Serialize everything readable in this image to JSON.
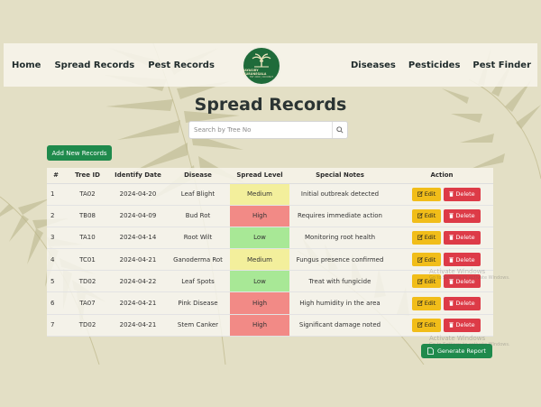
{
  "nav": {
    "left": [
      "Home",
      "Spread Records",
      "Pest Records"
    ],
    "right": [
      "Diseases",
      "Pesticides",
      "Pest Finder"
    ]
  },
  "logo": {
    "title": "JAYASIRY KURUNEGALA",
    "subtitle": "EST 2009 | COCONUT"
  },
  "page": {
    "title": "Spread Records"
  },
  "search": {
    "placeholder": "Search by Tree No"
  },
  "buttons": {
    "add": "Add New Records",
    "edit": "Edit",
    "delete": "Delete",
    "report": "Generate Report"
  },
  "table": {
    "headers": [
      "#",
      "Tree ID",
      "Identify Date",
      "Disease",
      "Spread Level",
      "Special Notes",
      "Action"
    ],
    "rows": [
      {
        "n": "1",
        "id": "TA02",
        "date": "2024-04-20",
        "disease": "Leaf Blight",
        "level": "Medium",
        "notes": "Initial outbreak detected"
      },
      {
        "n": "2",
        "id": "TB08",
        "date": "2024-04-09",
        "disease": "Bud Rot",
        "level": "High",
        "notes": "Requires immediate action"
      },
      {
        "n": "3",
        "id": "TA10",
        "date": "2024-04-14",
        "disease": "Root Wilt",
        "level": "Low",
        "notes": "Monitoring root health"
      },
      {
        "n": "4",
        "id": "TC01",
        "date": "2024-04-21",
        "disease": "Ganoderma Rot",
        "level": "Medium",
        "notes": "Fungus presence confirmed"
      },
      {
        "n": "5",
        "id": "TD02",
        "date": "2024-04-22",
        "disease": "Leaf Spots",
        "level": "Low",
        "notes": "Treat with fungicide"
      },
      {
        "n": "6",
        "id": "TA07",
        "date": "2024-04-21",
        "disease": "Pink Disease",
        "level": "High",
        "notes": "High humidity in the area"
      },
      {
        "n": "7",
        "id": "TD02",
        "date": "2024-04-21",
        "disease": "Stem Canker",
        "level": "High",
        "notes": "Significant damage noted"
      }
    ]
  },
  "watermark": {
    "title": "Activate Windows",
    "subtitle": "Go to Settings to activate Windows."
  },
  "colors": {
    "brand": "#1f8a4c",
    "edit": "#f1bd19",
    "delete": "#dd3b47",
    "medium": "#f3ef9c",
    "high": "#f28a86",
    "low": "#a8e896"
  }
}
